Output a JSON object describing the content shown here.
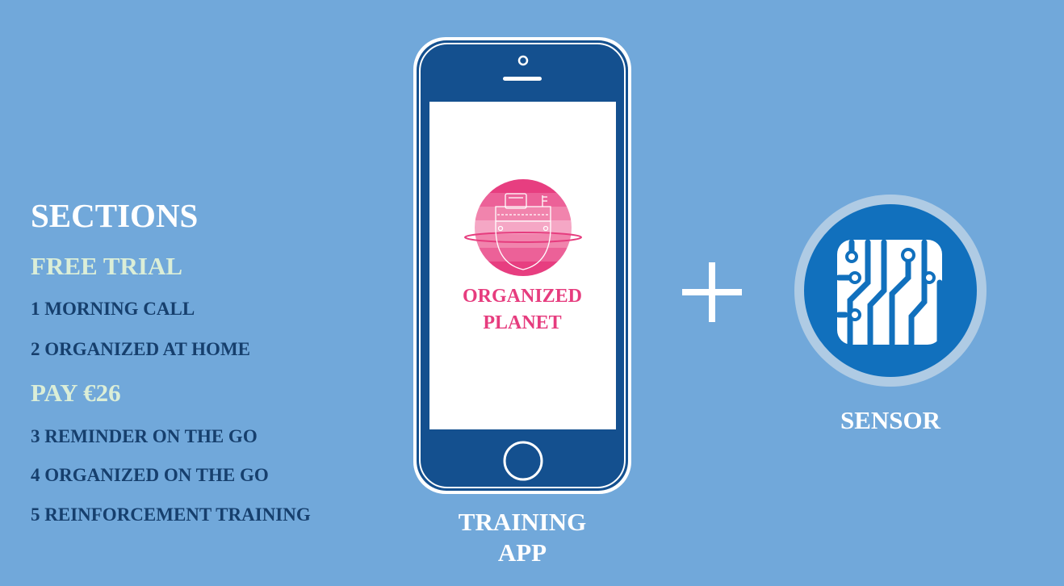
{
  "sections": {
    "title": "SECTIONS",
    "free_trial": "FREE TRIAL",
    "item1": "1 MORNING CALL",
    "item2": "2 ORGANIZED AT HOME",
    "pay": "PAY €26",
    "item3": "3 REMINDER ON THE GO",
    "item4": "4 ORGANIZED ON THE GO",
    "item5": "5 REINFORCEMENT TRAINING"
  },
  "app": {
    "logo_line1": "ORGANIZED",
    "logo_line2": "PLANET",
    "caption_line1": "TRAINING",
    "caption_line2": "APP"
  },
  "sensor": {
    "caption": "SENSOR",
    "icon": "circuit-chip-icon"
  },
  "colors": {
    "background": "#71a8da",
    "phone": "#14508f",
    "logo_pink": "#e63c7e",
    "sensor_blue": "#1170bd",
    "section_dark": "#163f6d",
    "section_green": "#dbeed7"
  }
}
